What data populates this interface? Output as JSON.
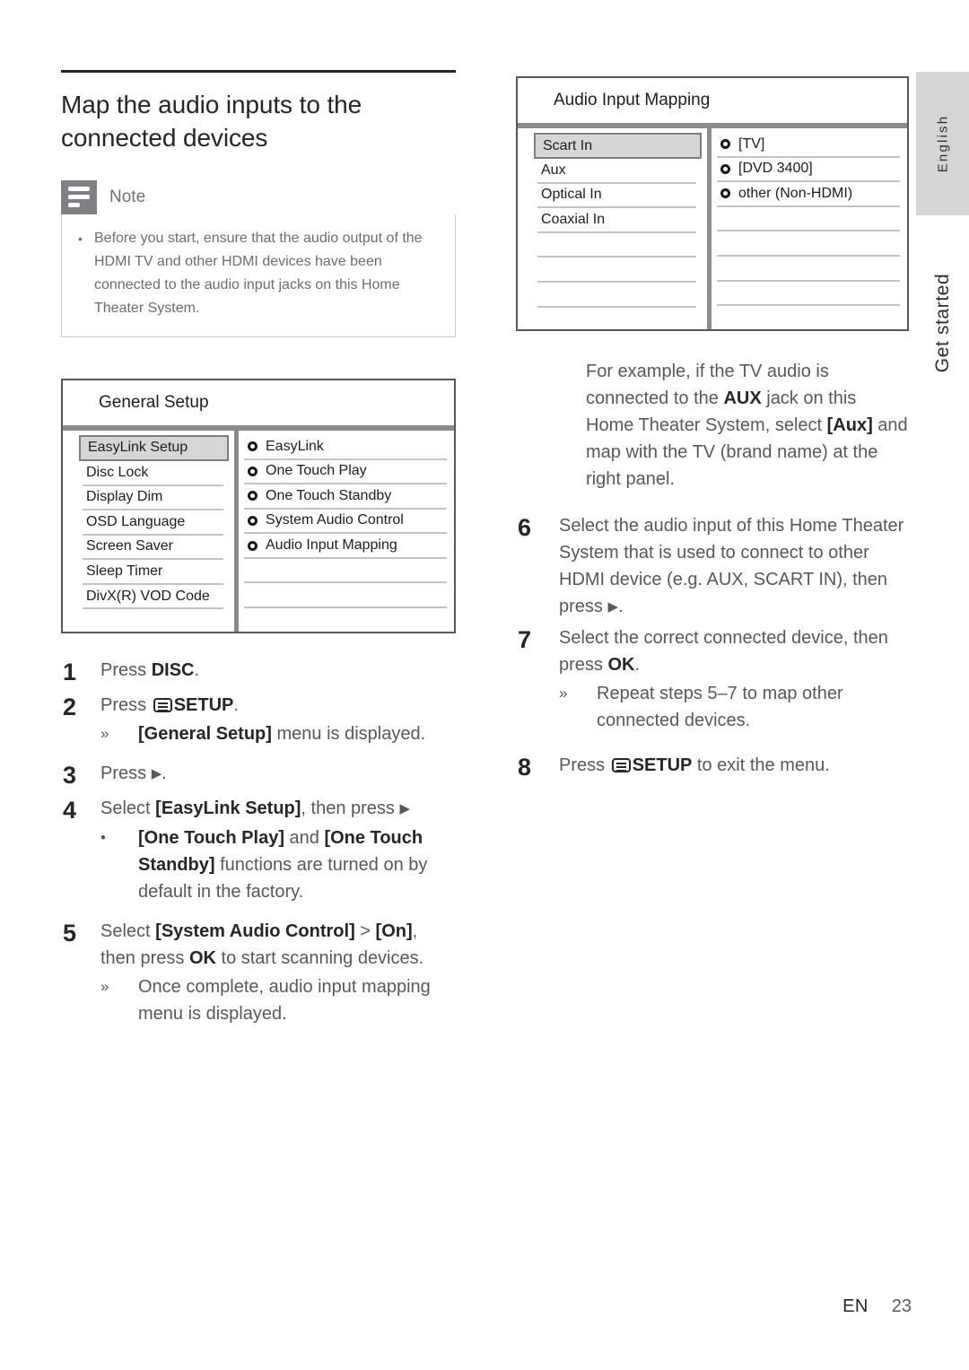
{
  "page": {
    "heading": "Map the audio inputs to the connected devices",
    "footer_locale": "EN",
    "footer_page": "23"
  },
  "side_tabs": {
    "language": "English",
    "section": "Get started"
  },
  "note": {
    "label": "Note",
    "bullet_marker": "•",
    "items": [
      "Before you start, ensure that the audio output of the HDMI TV and other HDMI devices have been connected to the audio input jacks on this Home Theater System."
    ]
  },
  "general_setup_menu": {
    "title": "General Setup",
    "left_items": [
      {
        "label": "EasyLink Setup",
        "selected": true
      },
      {
        "label": "Disc Lock",
        "selected": false
      },
      {
        "label": "Display Dim",
        "selected": false
      },
      {
        "label": "OSD Language",
        "selected": false
      },
      {
        "label": "Screen Saver",
        "selected": false
      },
      {
        "label": "Sleep Timer",
        "selected": false
      },
      {
        "label": "DivX(R) VOD Code",
        "selected": false
      },
      {
        "label": "",
        "selected": false
      }
    ],
    "right_items": [
      {
        "label": "EasyLink",
        "radio": true
      },
      {
        "label": "One Touch Play",
        "radio": true
      },
      {
        "label": "One Touch Standby",
        "radio": true
      },
      {
        "label": "System Audio Control",
        "radio": true
      },
      {
        "label": "Audio Input Mapping",
        "radio": true
      },
      {
        "label": "",
        "radio": false
      },
      {
        "label": "",
        "radio": false
      },
      {
        "label": "",
        "radio": false
      }
    ]
  },
  "audio_input_mapping_menu": {
    "title": "Audio Input Mapping",
    "left_items": [
      {
        "label": "Scart In",
        "selected": true
      },
      {
        "label": "Aux",
        "selected": false
      },
      {
        "label": "Optical In",
        "selected": false
      },
      {
        "label": "Coaxial In",
        "selected": false
      },
      {
        "label": "",
        "selected": false
      },
      {
        "label": "",
        "selected": false
      },
      {
        "label": "",
        "selected": false
      },
      {
        "label": "",
        "selected": false
      }
    ],
    "right_items": [
      {
        "label": "[TV]",
        "radio": true
      },
      {
        "label": "[DVD 3400]",
        "radio": true
      },
      {
        "label": "other (Non-HDMI)",
        "radio": true
      },
      {
        "label": "",
        "radio": false
      },
      {
        "label": "",
        "radio": false
      },
      {
        "label": "",
        "radio": false
      },
      {
        "label": "",
        "radio": false
      },
      {
        "label": "",
        "radio": false
      }
    ]
  },
  "steps_left": {
    "s1_num": "1",
    "s1_pre": "Press ",
    "s1_bold": "DISC",
    "s1_post": ".",
    "s2_num": "2",
    "s2_pre": "Press ",
    "s2_icon": "setup-icon",
    "s2_bold": "SETUP",
    "s2_post": ".",
    "s2_sub_mark": "»",
    "s2_sub_bold": "[General Setup]",
    "s2_sub_rest": " menu is displayed.",
    "s3_num": "3",
    "s3_pre": "Press ",
    "s3_arrow": "▶",
    "s3_post": ".",
    "s4_num": "4",
    "s4_pre": "Select ",
    "s4_bold": "[EasyLink Setup]",
    "s4_mid": ", then press ",
    "s4_arrow": "▶",
    "s4_sub_mark": "•",
    "s4_sub_b1": "[One Touch Play]",
    "s4_sub_m1": " and ",
    "s4_sub_b2": "[One Touch Standby]",
    "s4_sub_m2": " functions are turned on by default in the factory.",
    "s5_num": "5",
    "s5_pre": "Select ",
    "s5_b1": "[System Audio Control]",
    "s5_m1": " > ",
    "s5_b2": "[On]",
    "s5_m2": ", then press ",
    "s5_b3": "OK",
    "s5_m3": " to start scanning devices.",
    "s5_sub_mark": "»",
    "s5_sub_text": "Once complete, audio input mapping menu is displayed."
  },
  "steps_right": {
    "example_pre": "For example, if the TV audio is connected to the ",
    "example_b1": "AUX",
    "example_mid": " jack on this Home Theater System, select ",
    "example_b2": "[Aux]",
    "example_post": " and map with the TV (brand name) at the right panel.",
    "s6_num": "6",
    "s6_text_pre": "Select the audio input of this Home Theater System that is used to connect to other HDMI device (e.g. AUX, SCART IN), then press ",
    "s6_arrow": "▶",
    "s6_text_post": ".",
    "s7_num": "7",
    "s7_pre": "Select the correct connected device, then press ",
    "s7_bold": "OK",
    "s7_post": ".",
    "s7_sub_mark": "»",
    "s7_sub_text": "Repeat steps 5–7 to map other connected devices.",
    "s8_num": "8",
    "s8_pre": "Press ",
    "s8_icon": "setup-icon",
    "s8_bold": "SETUP",
    "s8_post": " to exit the menu."
  }
}
